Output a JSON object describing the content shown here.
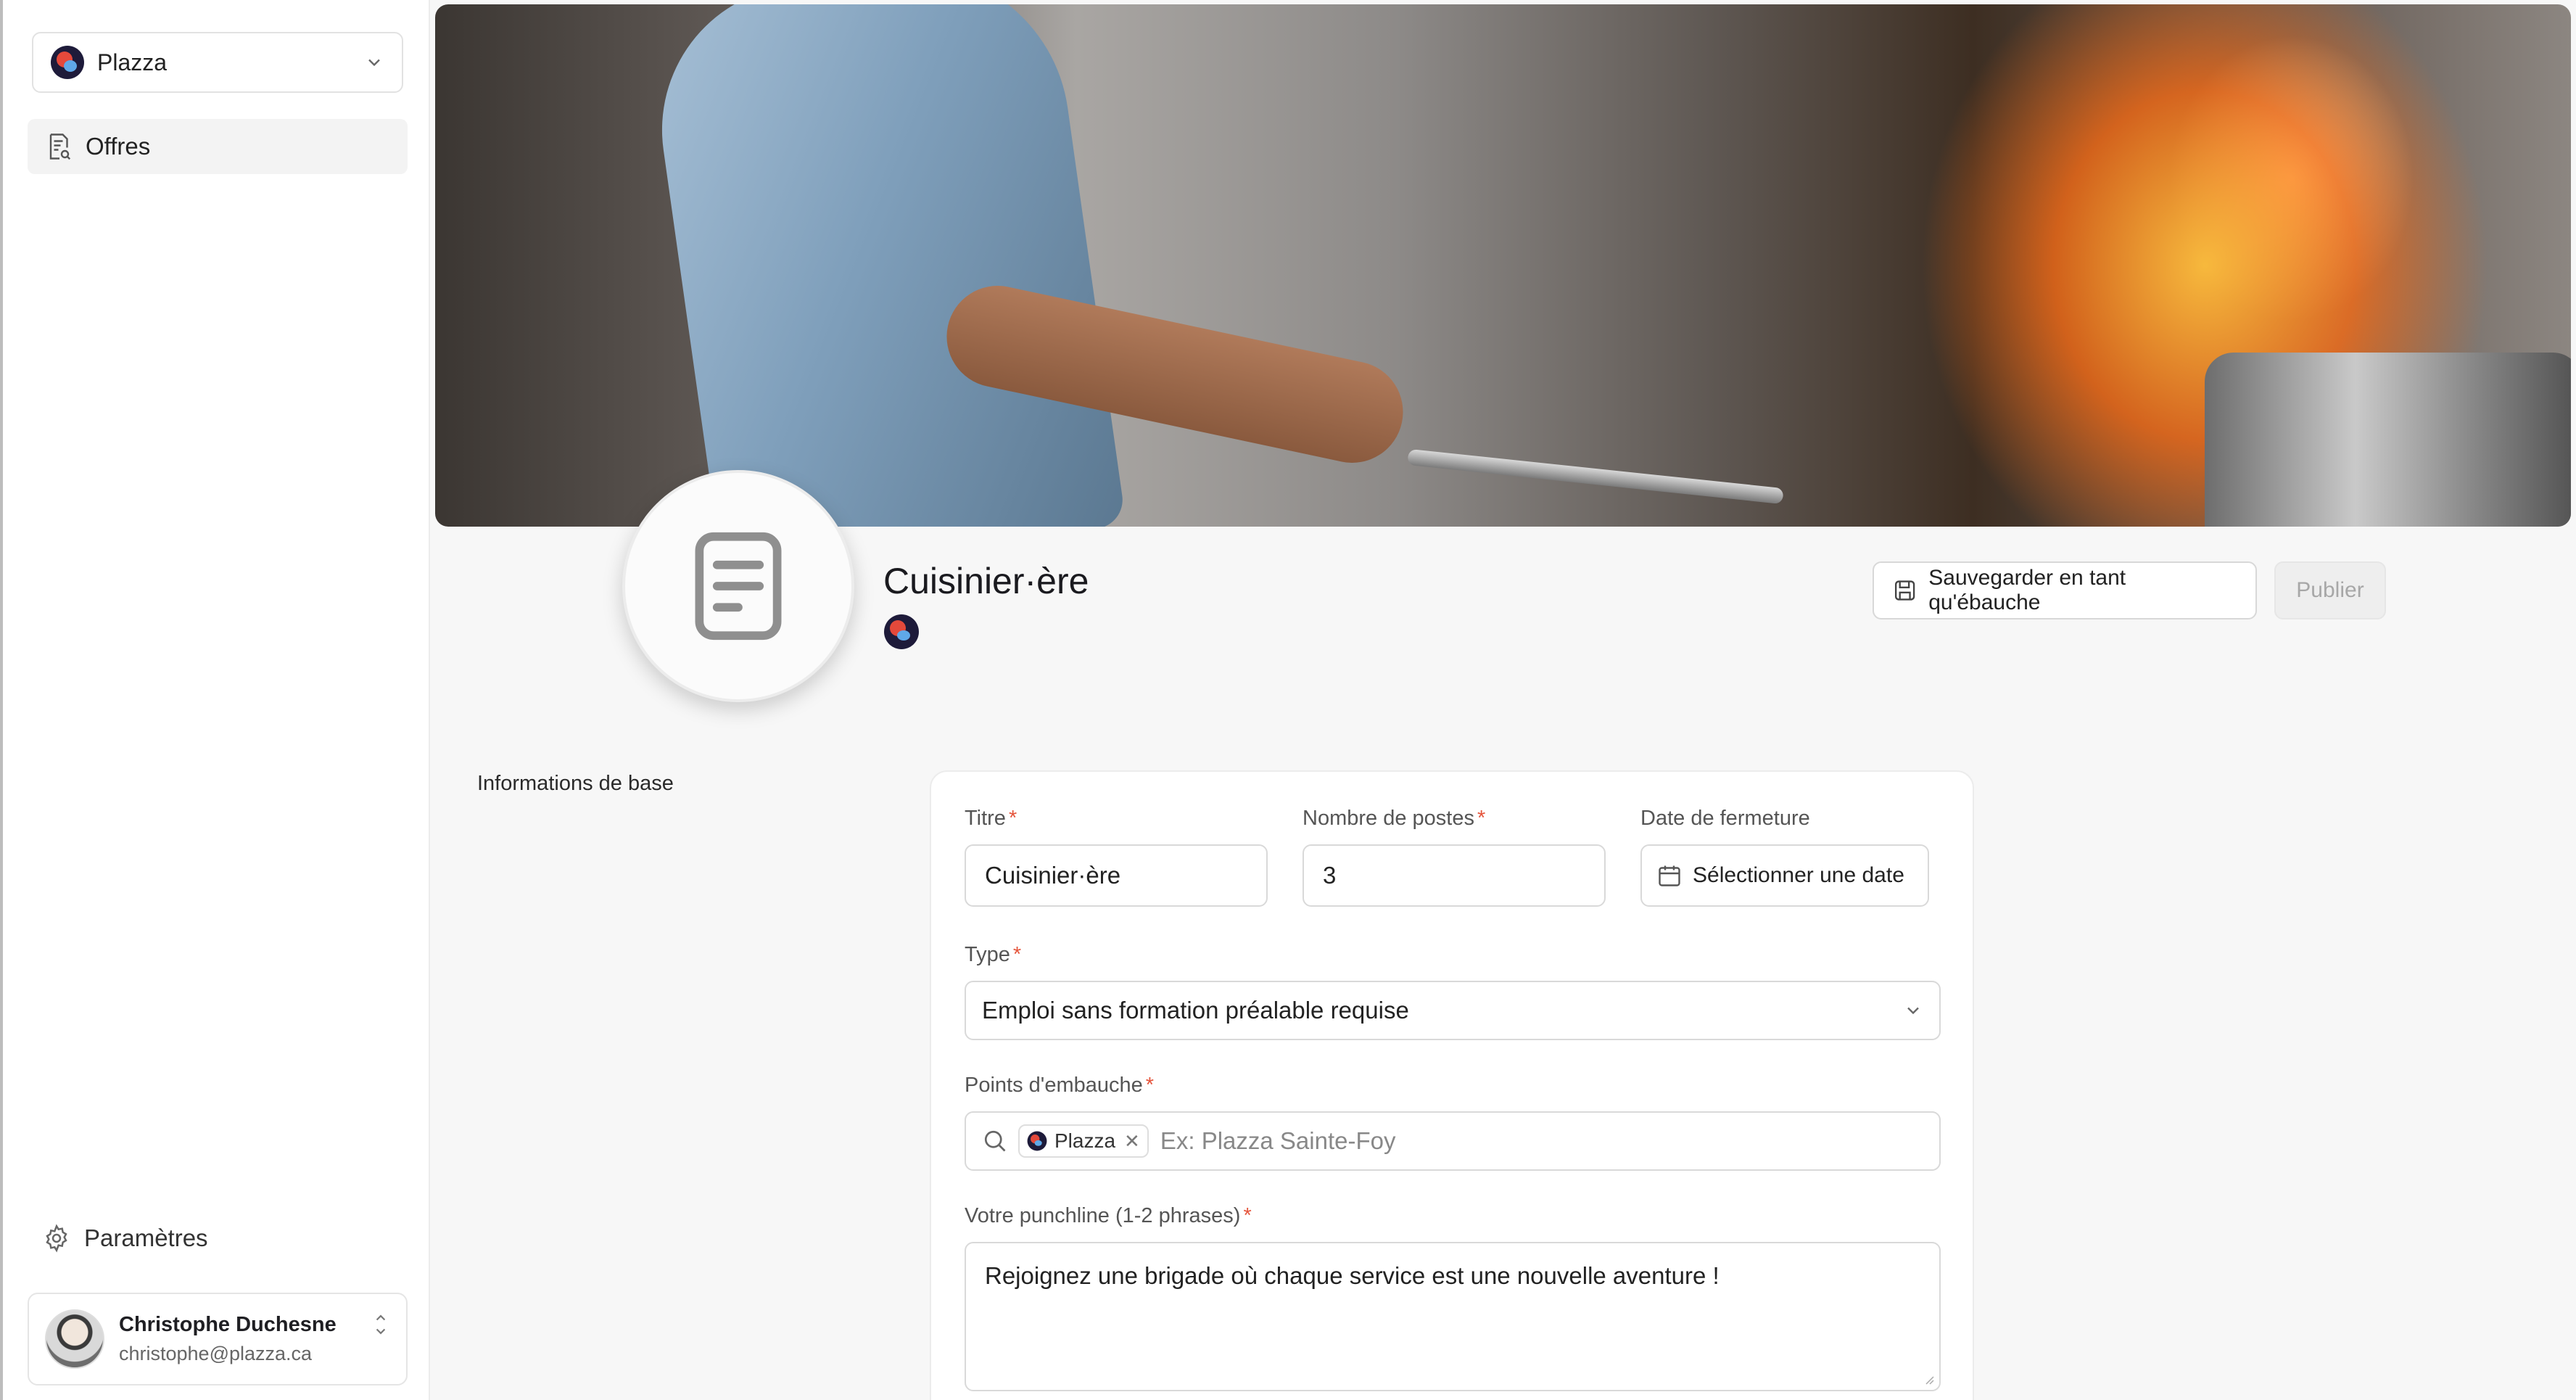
{
  "sidebar": {
    "org_name": "Plazza",
    "nav": [
      {
        "label": "Offres",
        "icon": "document-search-icon"
      }
    ],
    "settings_label": "Paramètres",
    "user": {
      "name": "Christophe Duchesne",
      "email": "christophe@plazza.ca"
    }
  },
  "header": {
    "title": "Cuisinier·ère",
    "save_draft_label": "Sauvegarder en tant qu'ébauche",
    "publish_label": "Publier"
  },
  "form": {
    "section_label": "Informations de base",
    "title_label": "Titre",
    "title_value": "Cuisinier·ère",
    "positions_label": "Nombre de postes",
    "positions_value": "3",
    "closing_date_label": "Date de fermeture",
    "closing_date_button": "Sélectionner une date",
    "type_label": "Type",
    "type_value": "Emploi sans formation préalable requise",
    "hiring_points_label": "Points d'embauche",
    "hiring_points_tag": "Plazza",
    "hiring_points_placeholder": "Ex: Plazza Sainte-Foy",
    "punchline_label": "Votre punchline (1-2 phrases)",
    "punchline_value": "Rejoignez une brigade où chaque service est une nouvelle aventure !"
  },
  "colors": {
    "accent_red": "#e5553c",
    "logo_dark": "#1e1b3a",
    "logo_red": "#e4493b",
    "logo_blue": "#5fa8e8"
  }
}
